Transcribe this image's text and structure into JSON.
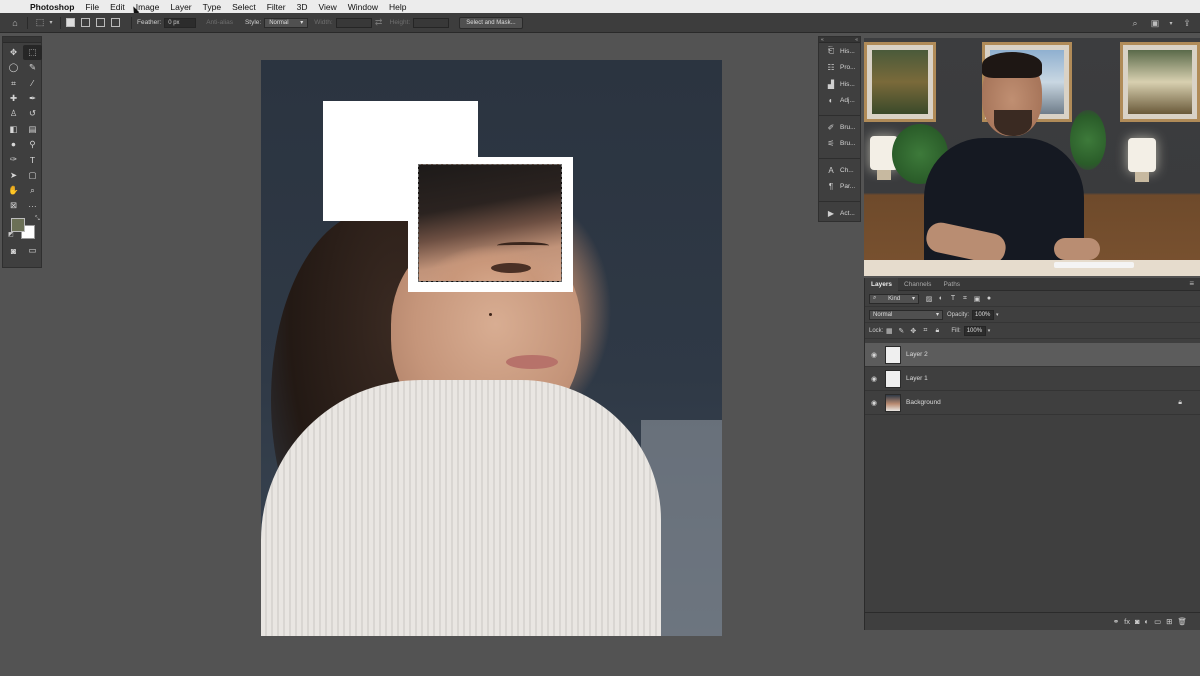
{
  "menubar": {
    "app_name": "Photoshop",
    "items": [
      "File",
      "Edit",
      "Image",
      "Layer",
      "Type",
      "Select",
      "Filter",
      "3D",
      "View",
      "Window",
      "Help"
    ]
  },
  "options_bar": {
    "feather_label": "Feather:",
    "feather_value": "0 px",
    "anti_alias_label": "Anti-alias",
    "style_label": "Style:",
    "style_value": "Normal",
    "width_label": "Width:",
    "height_label": "Height:",
    "select_and_mask_label": "Select and Mask..."
  },
  "toolbar": {
    "foreground_color": "#6b7056",
    "background_color": "#ffffff"
  },
  "panel_strip": {
    "items": [
      {
        "label": "His...",
        "icon": "history-icon"
      },
      {
        "label": "Pro...",
        "icon": "properties-icon"
      },
      {
        "label": "His...",
        "icon": "histogram-icon"
      },
      {
        "label": "Adj...",
        "icon": "adjustments-icon"
      },
      {
        "label": "Bru...",
        "icon": "brush-icon"
      },
      {
        "label": "Bru...",
        "icon": "brush-settings-icon"
      },
      {
        "label": "Ch...",
        "icon": "character-icon"
      },
      {
        "label": "Par...",
        "icon": "paragraph-icon"
      },
      {
        "label": "Act...",
        "icon": "actions-icon"
      }
    ]
  },
  "layers_panel": {
    "tabs": [
      "Layers",
      "Channels",
      "Paths"
    ],
    "filter_kind": "Kind",
    "blend_mode": "Normal",
    "opacity_label": "Opacity:",
    "opacity_value": "100%",
    "lock_label": "Lock:",
    "fill_label": "Fill:",
    "fill_value": "100%",
    "layers": [
      {
        "name": "Layer 2",
        "selected": true,
        "locked": false
      },
      {
        "name": "Layer 1",
        "selected": false,
        "locked": false
      },
      {
        "name": "Background",
        "selected": false,
        "locked": true
      }
    ]
  }
}
